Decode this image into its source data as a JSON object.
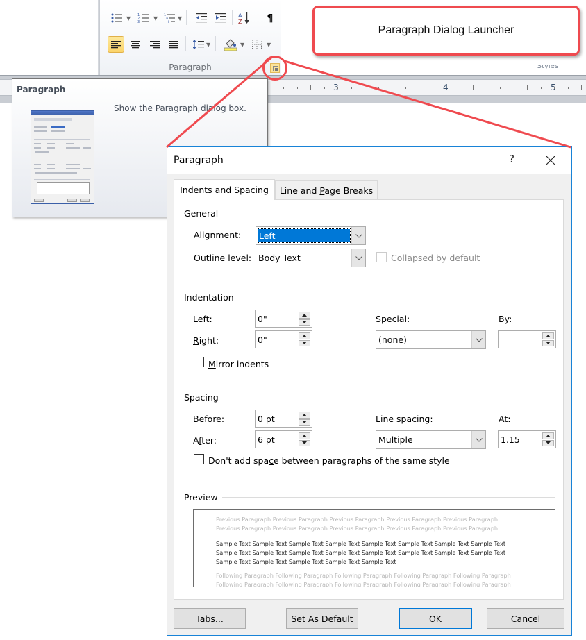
{
  "ribbon": {
    "group_label": "Paragraph",
    "styles_label": "Styles",
    "buttons": {
      "bullets": "bullets-icon",
      "numbering": "numbering-icon",
      "multilevel": "multilevel-list-icon",
      "decrease_indent": "decrease-indent-icon",
      "increase_indent": "increase-indent-icon",
      "sort": "sort-icon",
      "show_marks": "pilcrow-icon",
      "align_left": "align-left-icon",
      "center": "align-center-icon",
      "align_right": "align-right-icon",
      "justify": "justify-icon",
      "line_spacing": "line-spacing-icon",
      "shading": "shading-icon",
      "borders": "borders-icon"
    },
    "pilcrow": "¶",
    "launcher_icon": "dialog-launcher-icon"
  },
  "ruler": {
    "numbers": [
      "3",
      "4",
      "5"
    ]
  },
  "tooltip": {
    "title": "Paragraph",
    "description": "Show the Paragraph dialog box."
  },
  "callout": {
    "text": "Paragraph Dialog Launcher"
  },
  "dialog": {
    "title": "Paragraph",
    "help": "?",
    "tabs": [
      {
        "label": "Indents and Spacing",
        "accel": "I",
        "rest": "ndents and Spacing",
        "active": true
      },
      {
        "label": "Line and Page Breaks",
        "pre": "Line and ",
        "accel": "P",
        "rest": "age Breaks",
        "active": false
      }
    ],
    "general": {
      "heading": "General",
      "alignment": {
        "pre": "Ali",
        "accel": "g",
        "rest": "nment:",
        "value": "Left"
      },
      "outline_level": {
        "pre": "",
        "accel": "O",
        "rest": "utline level:",
        "value": "Body Text"
      },
      "collapsed": {
        "label": "Collapsed by default",
        "checked": false,
        "enabled": false
      }
    },
    "indentation": {
      "heading": "Indentation",
      "left": {
        "accel": "L",
        "rest": "eft:",
        "value": "0\""
      },
      "right": {
        "accel": "R",
        "rest": "ight:",
        "value": "0\""
      },
      "special": {
        "accel": "S",
        "rest": "pecial:",
        "value": "(none)"
      },
      "by": {
        "pre": "B",
        "accel": "y",
        "rest": ":",
        "value": ""
      },
      "mirror": {
        "accel": "M",
        "rest": "irror indents",
        "checked": false
      }
    },
    "spacing": {
      "heading": "Spacing",
      "before": {
        "accel": "B",
        "rest": "efore:",
        "value": "0 pt"
      },
      "after": {
        "pre": "A",
        "accel": "f",
        "rest": "ter:",
        "value": "6 pt"
      },
      "line_spacing": {
        "pre": "Li",
        "accel": "n",
        "rest": "e spacing:",
        "value": "Multiple"
      },
      "at": {
        "accel": "A",
        "rest": "t:",
        "value": "1.15"
      },
      "dont_add": {
        "pre": "Don't add spa",
        "accel": "c",
        "rest": "e between paragraphs of the same style",
        "checked": false
      }
    },
    "preview": {
      "heading": "Preview",
      "previous": "Previous Paragraph Previous Paragraph Previous Paragraph Previous Paragraph Previous Paragraph Previous Paragraph Previous Paragraph Previous Paragraph Previous Paragraph Previous Paragraph",
      "sample": "Sample Text Sample Text Sample Text Sample Text Sample Text Sample Text Sample Text Sample Text Sample Text Sample Text Sample Text Sample Text Sample Text Sample Text Sample Text Sample Text Sample Text Sample Text Sample Text Sample Text Sample Text",
      "following": "Following Paragraph Following Paragraph Following Paragraph Following Paragraph Following Paragraph Following Paragraph Following Paragraph Following Paragraph Following Paragraph Following Paragraph"
    },
    "buttons": {
      "tabs": {
        "accel": "T",
        "rest": "abs..."
      },
      "set_default": {
        "pre": "Set As ",
        "accel": "D",
        "rest": "efault"
      },
      "ok": "OK",
      "cancel": "Cancel"
    }
  },
  "colors": {
    "callout_border": "#ef4a4f",
    "dialog_border": "#1883d7",
    "selection": "#0078d7",
    "ribbon_selected": "#fbd46a"
  }
}
